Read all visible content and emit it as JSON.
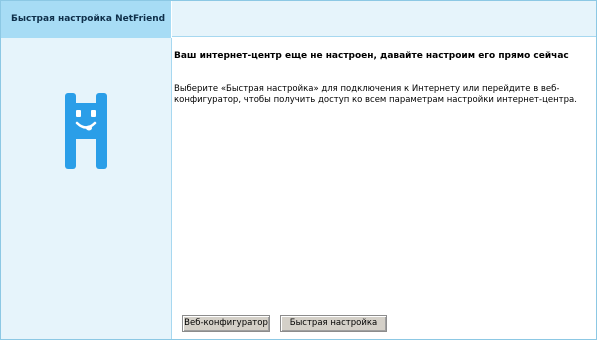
{
  "tab": {
    "label": "Быстрая настройка NetFriend"
  },
  "main": {
    "heading": "Ваш интернет-центр еще не настроен, давайте настроим его прямо сейчас",
    "description": "Выберите «Быстрая настройка» для подключения к Интернету или перейдите в веб-конфигуратор, чтобы получить доступ ко всем параметрам настройки интернет-центра."
  },
  "buttons": {
    "web_label": "Веб-конфигуратор",
    "quick_label": "Быстрая настройка"
  },
  "colors": {
    "accent": "#a7dcf5",
    "panel_bg": "#e6f4fb",
    "mascot": "#2a9ee8"
  },
  "icons": {
    "mascot": "netfriend-mascot-icon"
  }
}
